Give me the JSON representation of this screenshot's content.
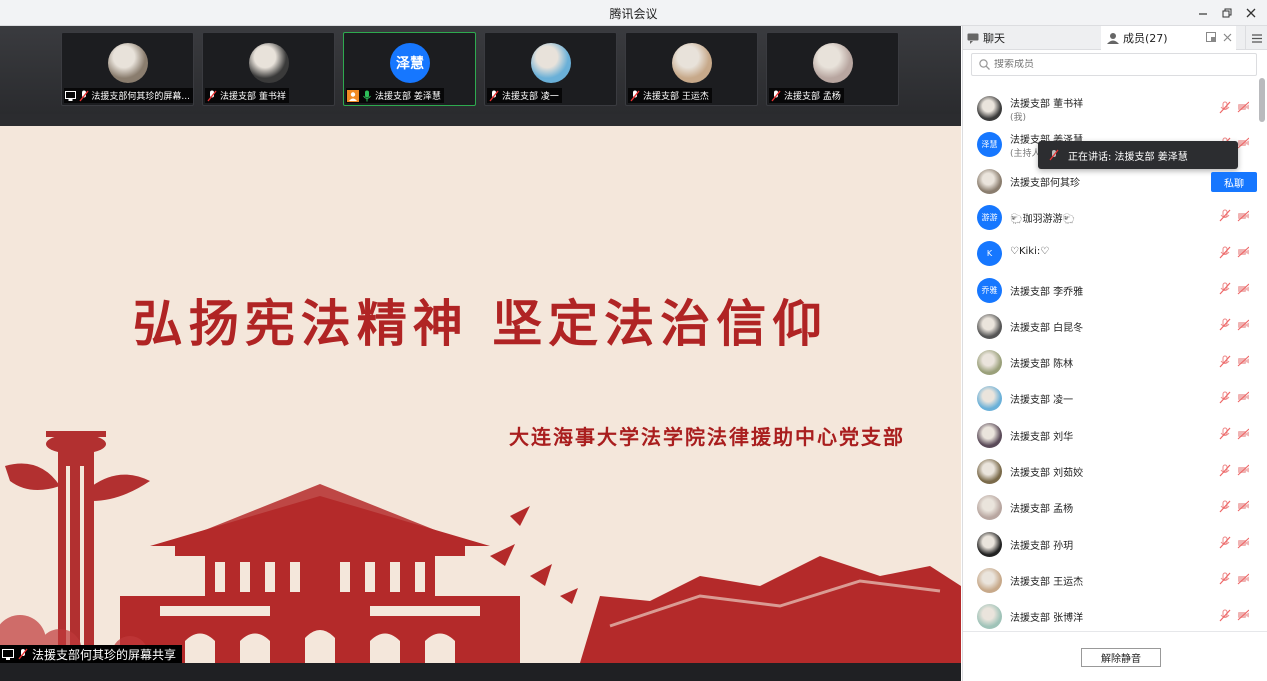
{
  "window": {
    "title": "腾讯会议",
    "controls": [
      "minimize-icon",
      "restore-icon",
      "close-icon"
    ]
  },
  "video_strip": [
    {
      "name": "法援支部何其珍的屏幕...",
      "avatar": "photo",
      "avatar_color": "#8a7d6e",
      "screen_share": true,
      "mic": "muted",
      "active": false
    },
    {
      "name": "法援支部 董书祥",
      "avatar": "photo",
      "avatar_color": "#3a3a3a",
      "screen_share": false,
      "mic": "muted",
      "active": false
    },
    {
      "name": "法援支部 姜泽慧",
      "avatar": "泽慧",
      "avatar_color": "#1677ff",
      "host_icon": true,
      "screen_share": false,
      "mic": "speaking",
      "active": true
    },
    {
      "name": "法援支部 凌一",
      "avatar": "photo",
      "avatar_color": "#6ab0d8",
      "screen_share": false,
      "mic": "muted",
      "active": false
    },
    {
      "name": "法援支部 王运杰",
      "avatar": "photo",
      "avatar_color": "#c7a98a",
      "screen_share": false,
      "mic": "muted",
      "active": false
    },
    {
      "name": "法援支部  孟杨",
      "avatar": "photo",
      "avatar_color": "#b8a6a0",
      "screen_share": false,
      "mic": "muted",
      "active": false
    }
  ],
  "slide": {
    "title": "弘扬宪法精神  坚定法治信仰",
    "subtitle": "大连海事大学法学院法律援助中心党支部",
    "bg_color": "#f4e7db",
    "accent": "#b02424"
  },
  "share_label": "法援支部何其珍的屏幕共享",
  "panel": {
    "tab_chat": "聊天",
    "tab_members": "成员(27)",
    "search_placeholder": "搜索成员",
    "tooltip": "正在讲话: 法援支部 姜泽慧",
    "private_chat": "私聊",
    "unmute_all": "解除静音",
    "members": [
      {
        "name": "法援支部 董书祥",
        "sub": "(我)",
        "avatar": "photo",
        "avatar_color": "#3a3a3a"
      },
      {
        "name": "法援支部 姜泽慧",
        "sub": "(主持人)",
        "avatar": "泽慧",
        "avatar_color": "#1677ff"
      },
      {
        "name": "法援支部何其珍",
        "sub": "",
        "avatar": "photo",
        "avatar_color": "#8a7d6e"
      },
      {
        "name": "🐑珈羽游游🐑",
        "sub": "",
        "avatar": "游游",
        "avatar_color": "#1677ff"
      },
      {
        "name": "♡Kiki:♡",
        "sub": "",
        "avatar": "K",
        "avatar_color": "#1677ff"
      },
      {
        "name": "法援支部  李乔雅",
        "sub": "",
        "avatar": "乔雅",
        "avatar_color": "#1677ff"
      },
      {
        "name": "法援支部 白昆冬",
        "sub": "",
        "avatar": "photo",
        "avatar_color": "#555"
      },
      {
        "name": "法援支部 陈林",
        "sub": "",
        "avatar": "photo",
        "avatar_color": "#9aa07a"
      },
      {
        "name": "法援支部 凌一",
        "sub": "",
        "avatar": "photo",
        "avatar_color": "#6ab0d8"
      },
      {
        "name": "法援支部 刘华",
        "sub": "",
        "avatar": "photo",
        "avatar_color": "#5a4a58"
      },
      {
        "name": "法援支部 刘茹姣",
        "sub": "",
        "avatar": "photo",
        "avatar_color": "#7a6a4a"
      },
      {
        "name": "法援支部    孟杨",
        "sub": "",
        "avatar": "photo",
        "avatar_color": "#b8a6a0"
      },
      {
        "name": "法援支部 孙玥",
        "sub": "",
        "avatar": "photo",
        "avatar_color": "#222"
      },
      {
        "name": "法援支部 王运杰",
        "sub": "",
        "avatar": "photo",
        "avatar_color": "#c7a98a"
      },
      {
        "name": "法援支部 张博洋",
        "sub": "",
        "avatar": "photo",
        "avatar_color": "#9fc3b8"
      }
    ]
  }
}
